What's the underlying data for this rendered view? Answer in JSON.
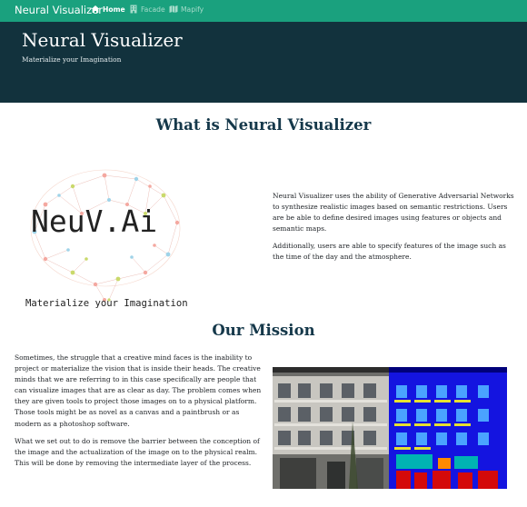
{
  "navbar": {
    "brand": "Neural Visualizer",
    "links": [
      {
        "label": "Home",
        "icon": "home-icon",
        "active": true
      },
      {
        "label": "Facade",
        "icon": "building-icon",
        "active": false
      },
      {
        "label": "Mapify",
        "icon": "map-icon",
        "active": false
      }
    ]
  },
  "header": {
    "title": "Neural Visualizer",
    "subtitle": "Materialize your Imagination"
  },
  "about": {
    "heading": "What is Neural Visualizer",
    "logo_text": "NeuV.Ai",
    "logo_tagline": "Materialize your Imagination",
    "paragraphs": [
      "Neural Visualizer uses the ability of Generative Adversarial Networks to synthesize realistic images based on semantic restrictions. Users are be able to define desired images using features or objects and semantic maps.",
      "Additionally, users are able to specify features of the image such as the time of the day and the atmosphere."
    ]
  },
  "mission": {
    "heading": "Our Mission",
    "paragraphs": [
      "Sometimes, the struggle that a creative mind faces is the inability to project or materialize the vision that is inside their heads. The creative minds that we are referring to in this case specifically are people that can visualize images that are as clear as day. The problem comes when they are given tools to project those images on to a physical platform. Those tools might be as novel as a canvas and a paintbrush or as modern as a photoshop software.",
      "What we set out to do is remove the barrier between the conception of the image and the actualization of the image on to the physical realm. This will be done by removing the intermediate layer of the process."
    ]
  },
  "colors": {
    "navbar": "#1aa17e",
    "header": "#12323d",
    "heading": "#15384a"
  }
}
